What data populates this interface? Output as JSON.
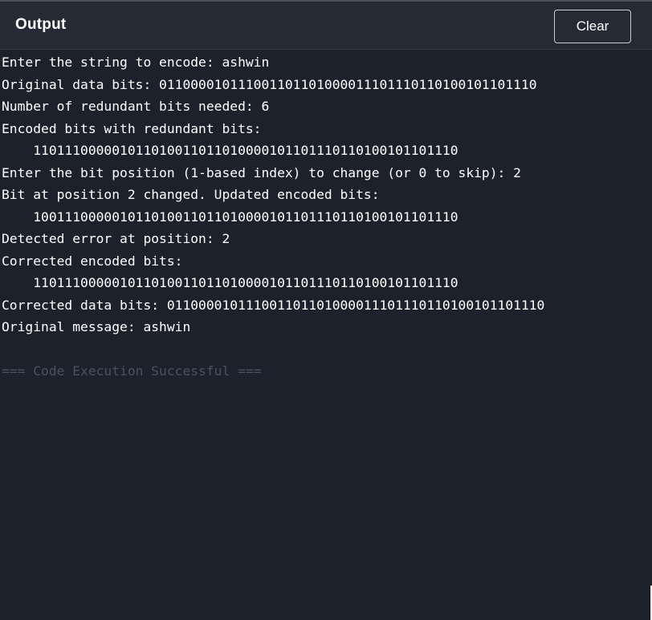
{
  "header": {
    "title": "Output",
    "clear_label": "Clear"
  },
  "console": {
    "lines": [
      "Enter the string to encode: ashwin",
      "Original data bits: 011000010111001101101000011101110110100101101110",
      "Number of redundant bits needed: 6",
      "Encoded bits with redundant bits:",
      "    110111000001011010011011010000101101110110100101101110",
      "Enter the bit position (1-based index) to change (or 0 to skip): 2",
      "Bit at position 2 changed. Updated encoded bits:",
      "    100111000001011010011011010000101101110110100101101110",
      "Detected error at position: 2",
      "Corrected encoded bits:",
      "    110111000001011010011011010000101101110110100101101110",
      "Corrected data bits: 011000010111001101101000011101110110100101101110",
      "Original message: ashwin",
      "",
      "=== Code Execution Successful ==="
    ]
  }
}
